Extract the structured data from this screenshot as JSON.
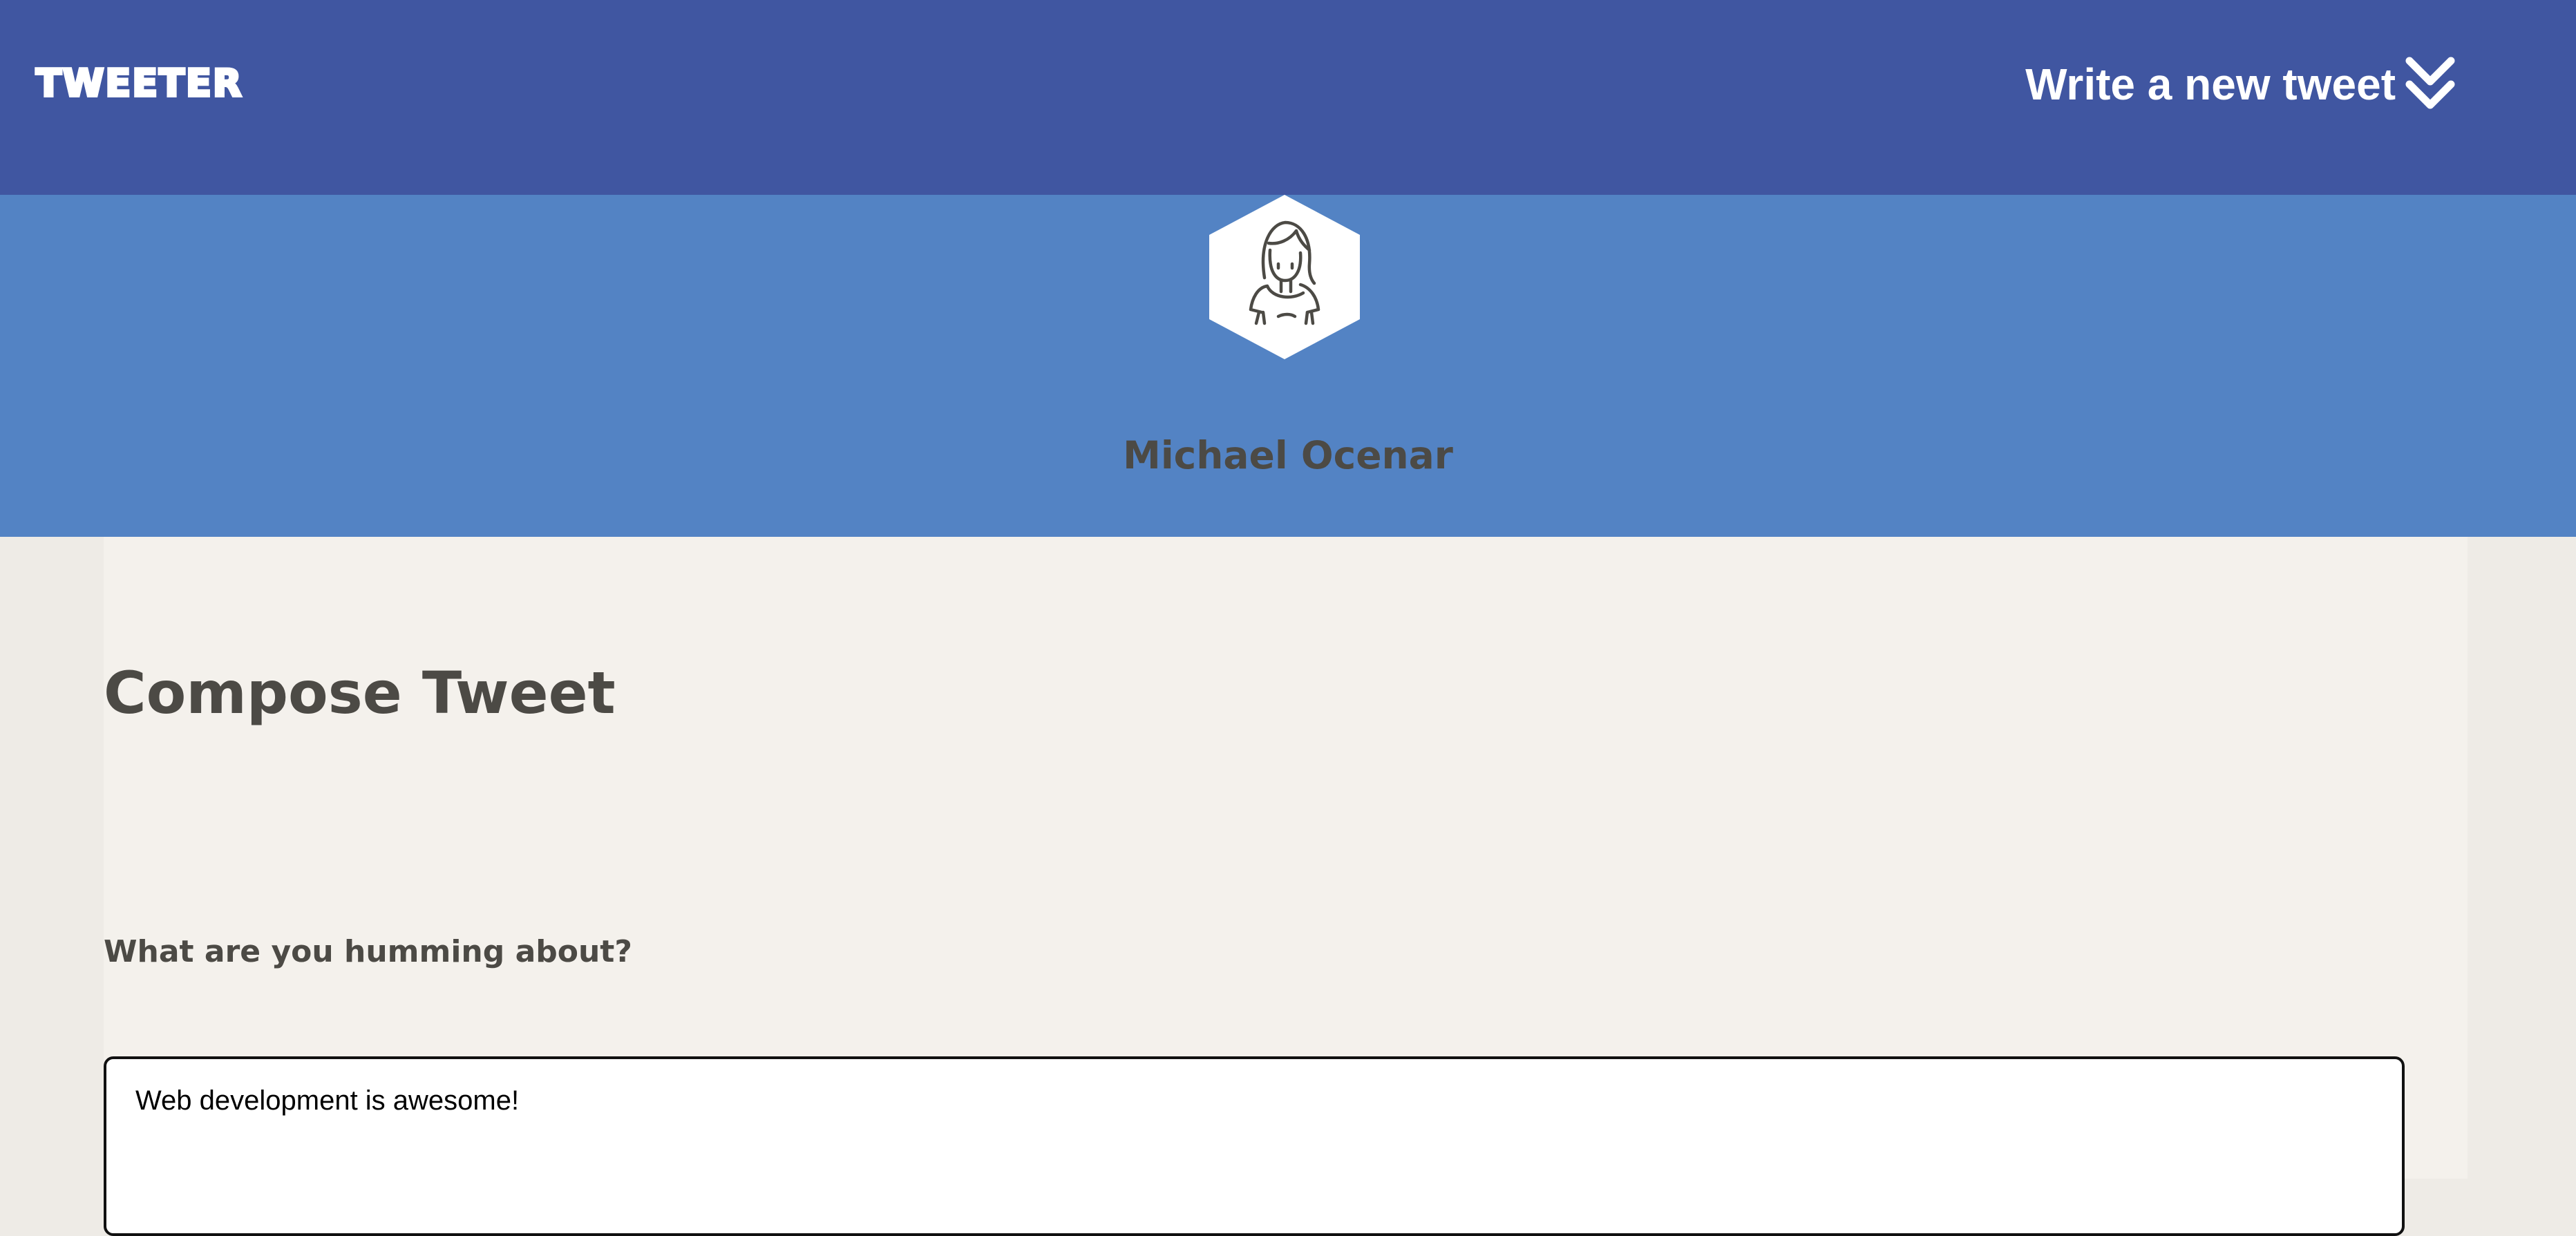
{
  "header": {
    "brand": "TWEETER",
    "new_tweet_label": "Write a new tweet",
    "new_tweet_icon": "double-chevron-down-icon"
  },
  "profile": {
    "avatar_icon": "user-avatar-icon",
    "name": "Michael Ocenar"
  },
  "compose": {
    "title": "Compose Tweet",
    "prompt_label": "What are you humming about?",
    "tweet_text": "Web development is awesome!"
  },
  "colors": {
    "header_bg": "#4056a1",
    "banner_bg": "#5383c4",
    "page_bg": "#f4f1ec",
    "text_dark": "#4c4a45"
  }
}
